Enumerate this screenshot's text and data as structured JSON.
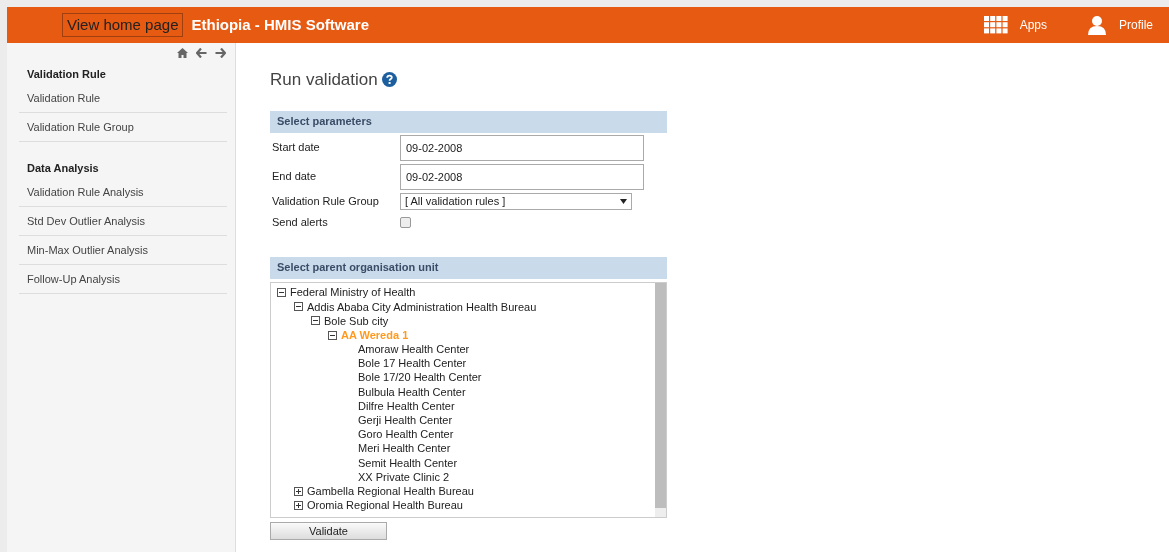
{
  "header": {
    "logo_alt": "View home page",
    "title": "Ethiopia - HMIS Software",
    "menu": [
      {
        "kind": "apps",
        "label": "Apps"
      },
      {
        "kind": "profile",
        "label": "Profile"
      }
    ]
  },
  "sidebar": {
    "sections": [
      {
        "title": "Validation Rule",
        "items": [
          "Validation Rule",
          "Validation Rule Group"
        ]
      },
      {
        "title": "Data Analysis",
        "items": [
          "Validation Rule Analysis",
          "Std Dev Outlier Analysis",
          "Min-Max Outlier Analysis",
          "Follow-Up Analysis"
        ]
      }
    ]
  },
  "page_title": "Run validation",
  "parameters": {
    "heading": "Select parameters",
    "fields": [
      {
        "kind": "text",
        "label": "Start date",
        "value": "09-02-2008"
      },
      {
        "kind": "text",
        "label": "End date",
        "value": "09-02-2008"
      },
      {
        "kind": "select",
        "label": "Validation Rule Group",
        "value": "[ All validation rules ]"
      },
      {
        "kind": "checkbox",
        "label": "Send alerts",
        "checked": false
      }
    ]
  },
  "org_units": {
    "heading": "Select parent organisation unit",
    "tree": [
      {
        "label": "Federal Ministry of Health",
        "expanded": true,
        "selected": false,
        "children": [
          {
            "label": "Addis Ababa City Administration Health Bureau",
            "expanded": true,
            "selected": false,
            "children": [
              {
                "label": "Bole Sub city",
                "expanded": true,
                "selected": false,
                "children": [
                  {
                    "label": "AA Wereda 1",
                    "expanded": true,
                    "selected": true,
                    "children": [
                      {
                        "label": "Amoraw Health Center",
                        "selected": false
                      },
                      {
                        "label": "Bole 17 Health Center",
                        "selected": false
                      },
                      {
                        "label": "Bole 17/20 Health Center",
                        "selected": false
                      },
                      {
                        "label": "Bulbula Health Center",
                        "selected": false
                      },
                      {
                        "label": "Dilfre Health Center",
                        "selected": false
                      },
                      {
                        "label": "Gerji Health Center",
                        "selected": false
                      },
                      {
                        "label": "Goro Health Center",
                        "selected": false
                      },
                      {
                        "label": "Meri Health Center",
                        "selected": false
                      },
                      {
                        "label": "Semit Health Center",
                        "selected": false
                      },
                      {
                        "label": "XX Private Clinic 2",
                        "selected": false
                      }
                    ]
                  }
                ]
              }
            ]
          },
          {
            "label": "Gambella Regional Health Bureau",
            "expanded": false,
            "selected": false
          },
          {
            "label": "Oromia Regional Health Bureau",
            "expanded": false,
            "selected": false
          }
        ]
      }
    ]
  },
  "validate_button": "Validate"
}
